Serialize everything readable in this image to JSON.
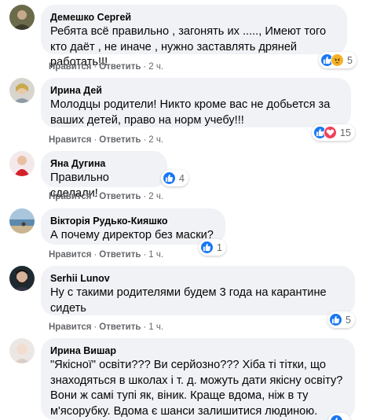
{
  "comments": [
    {
      "author": "Демешко Сергей",
      "text": "Ребята всё правильно , загонять их ....., Имеют того кто даёт , не иначе , нужно заставлять дряней работать!!!",
      "like_label": "Нравится",
      "reply_label": "Ответить",
      "time": "2 ч.",
      "reactions": [
        "like-icon",
        "angry-icon"
      ],
      "reaction_count": "5"
    },
    {
      "author": "Ирина Дей",
      "text": "Молодцы родители! Никто кроме вас не добьется за ваших детей, право на норм учебу!!!",
      "like_label": "Нравится",
      "reply_label": "Ответить",
      "time": "2 ч.",
      "reactions": [
        "like-icon",
        "love-icon"
      ],
      "reaction_count": "15"
    },
    {
      "author": "Яна Дугина",
      "text": "Правильно сделали!",
      "like_label": "Нравится",
      "reply_label": "Ответить",
      "time": "2 ч.",
      "reactions": [
        "like-icon"
      ],
      "reaction_count": "4"
    },
    {
      "author": "Вікторія Рудько-Кияшко",
      "text": "А почему директор без маски?",
      "like_label": "Нравится",
      "reply_label": "Ответить",
      "time": "1 ч.",
      "reactions": [
        "like-icon"
      ],
      "reaction_count": "1"
    },
    {
      "author": "Serhii Lunov",
      "text": "Ну с такими родителями будем 3 года на карантине сидеть",
      "like_label": "Нравится",
      "reply_label": "Ответить",
      "time": "1 ч.",
      "reactions": [
        "like-icon"
      ],
      "reaction_count": "5"
    },
    {
      "author": "Ирина Вишар",
      "text": "\"Якісної\" освіти??? Ви серйозно??? Хіба ті тітки, що знаходяться в школах і т. д. можуть дати якісну освіту? Вони ж самі тупі як, віник. Краще вдома, ніж в ту м'ясорубку. Вдома є шанси залишитися людиною.",
      "reactions": [
        "like-icon"
      ],
      "reaction_count": ""
    }
  ],
  "colors": {
    "bubble": "#f0f2f5",
    "meta_text": "#65676b",
    "like": "#1877f2",
    "love": "#f33e58",
    "angry": "#f7b125"
  }
}
